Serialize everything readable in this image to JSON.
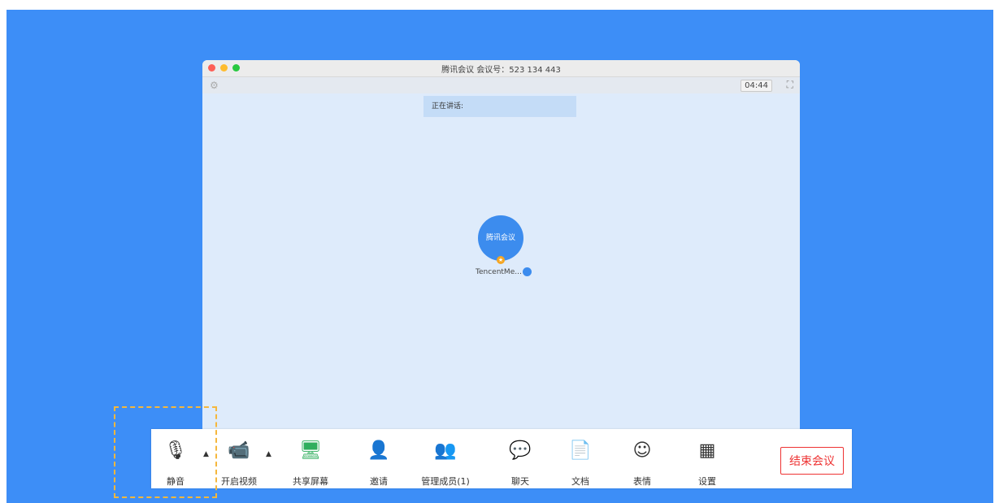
{
  "window": {
    "title": "腾讯会议 会议号：523 134 443",
    "timer": "04:44",
    "speaking_label": "正在讲话:"
  },
  "participant": {
    "avatar_text": "腾讯会议",
    "name": "TencentMe..."
  },
  "toolbar": {
    "mute": "静音",
    "video": "开启视频",
    "share": "共享屏幕",
    "invite": "邀请",
    "members": "管理成员(1)",
    "chat": "聊天",
    "docs": "文档",
    "emoji": "表情",
    "settings": "设置",
    "end": "结束会议"
  },
  "icons": {
    "gear": "gear-icon",
    "fullscreen": "fullscreen-icon",
    "mic": "microphone-icon",
    "video_off": "video-off-icon",
    "share": "share-screen-icon",
    "invite": "invite-user-icon",
    "members": "members-icon",
    "chat": "chat-icon",
    "docs": "document-icon",
    "emoji": "emoji-icon",
    "settings": "settings-grid-icon"
  },
  "colors": {
    "background": "#3d8ef7",
    "accent": "#3c8cee",
    "end_button": "#e33333"
  }
}
